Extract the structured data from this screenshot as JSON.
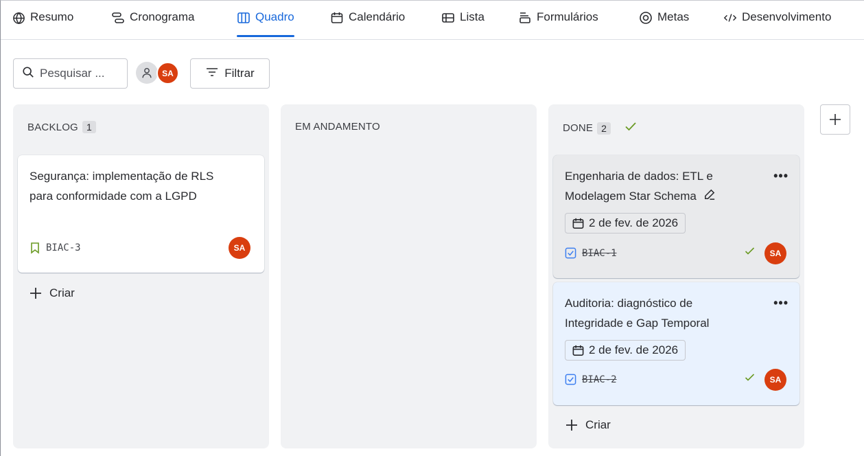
{
  "tabs": [
    {
      "label": "Resumo",
      "icon": "globe-icon"
    },
    {
      "label": "Cronograma",
      "icon": "timeline-icon"
    },
    {
      "label": "Quadro",
      "icon": "board-icon",
      "active": true
    },
    {
      "label": "Calendário",
      "icon": "calendar-icon"
    },
    {
      "label": "Lista",
      "icon": "list-icon"
    },
    {
      "label": "Formulários",
      "icon": "forms-icon"
    },
    {
      "label": "Metas",
      "icon": "target-icon"
    },
    {
      "label": "Desenvolvimento",
      "icon": "code-icon"
    }
  ],
  "toolbar": {
    "search_placeholder": "Pesquisar ...",
    "avatar_initials": "SA",
    "filter_label": "Filtrar"
  },
  "columns": [
    {
      "title": "BACKLOG",
      "count": "1",
      "create_label": "Criar",
      "cards": [
        {
          "title": "Segurança: implementação de RLS para conformidade com a LGPD",
          "key": "BIAC-3",
          "key_icon": "bookmark-icon",
          "assignee": "SA"
        }
      ]
    },
    {
      "title": "EM ANDAMENTO",
      "cards": []
    },
    {
      "title": "DONE",
      "count": "2",
      "create_label": "Criar",
      "cards": [
        {
          "title": "Engenharia de dados: ETL e Modelagem Star Schema",
          "date": "2 de fev. de 2026",
          "key": "BIAC-1",
          "key_icon": "checkbox-icon",
          "assignee": "SA"
        },
        {
          "title": "Auditoria: diagnóstico de Integridade e Gap Temporal",
          "date": "2 de fev. de 2026",
          "key": "BIAC-2",
          "key_icon": "checkbox-icon",
          "assignee": "SA"
        }
      ]
    }
  ],
  "colors": {
    "accent": "#1868db",
    "avatar": "#d93e0f",
    "done_check": "#5b7f24",
    "column_bg": "#f1f2f4",
    "selected_card": "#e9f2fe"
  }
}
